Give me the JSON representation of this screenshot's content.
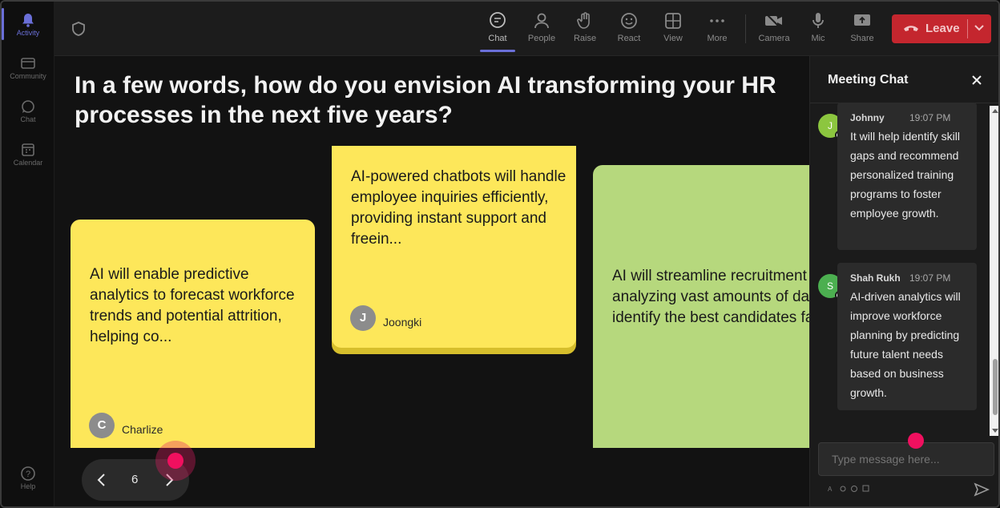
{
  "rail": {
    "items": [
      {
        "label": "Activity"
      },
      {
        "label": "Community"
      },
      {
        "label": "Chat"
      },
      {
        "label": "Calendar"
      },
      {
        "label": "Help"
      }
    ]
  },
  "toolbar": {
    "chat": "Chat",
    "people": "People",
    "raise": "Raise",
    "react": "React",
    "view": "View",
    "more": "More",
    "camera": "Camera",
    "mic": "Mic",
    "share": "Share",
    "leave": "Leave"
  },
  "stage": {
    "question": "In a few words, how do you envision AI transforming your HR processes in the next five years?",
    "notes": [
      {
        "text": "AI will enable predictive analytics to forecast workforce trends and potential attrition, helping co...",
        "initial": "C",
        "author": "Charlize",
        "color": "#fde75a"
      },
      {
        "text": "AI-powered chatbots will handle employee inquiries efficiently, providing instant support and freein...",
        "initial": "J",
        "author": "Joongki",
        "color": "#fde75a"
      },
      {
        "text": "AI will streamline recruitment by analyzing vast amounts of data to identify the best candidates fas...",
        "color": "#b6d87d"
      }
    ],
    "pager": {
      "page": "6"
    }
  },
  "chat": {
    "title": "Meeting Chat",
    "messages": [
      {
        "initial": "J",
        "author": "Johnny",
        "time": "19:07 PM",
        "text": "It will help identify skill gaps and recommend personalized training programs to foster employee growth.",
        "avatar_color": "#8cc63f"
      },
      {
        "initial": "S",
        "author": "Shah Rukh",
        "time": "19:07 PM",
        "text": "AI-driven analytics will improve workforce planning by predicting future talent needs based on business growth.",
        "avatar_color": "#4caf50"
      }
    ],
    "input_placeholder": "Type message here..."
  },
  "colors": {
    "accent": "#6a6fd8",
    "leave": "#c4262e",
    "cursor": "#f0105f"
  }
}
